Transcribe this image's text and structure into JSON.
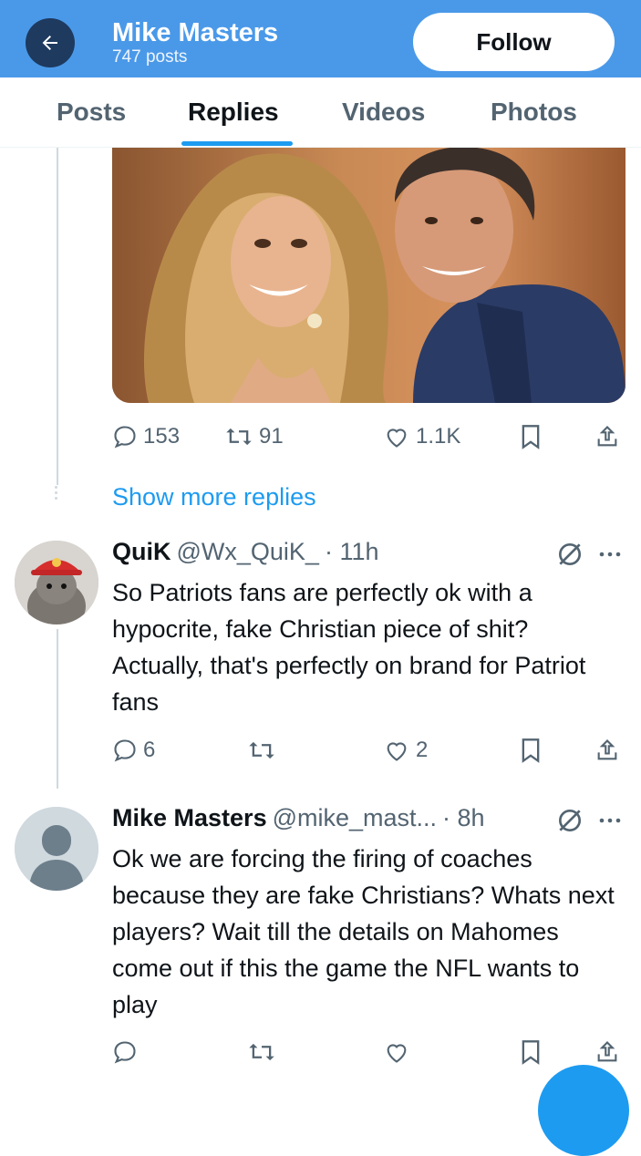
{
  "header": {
    "title": "Mike Masters",
    "subtitle": "747 posts",
    "follow_label": "Follow"
  },
  "tabs": [
    {
      "label": "Posts"
    },
    {
      "label": "Replies"
    },
    {
      "label": "Videos"
    },
    {
      "label": "Photos"
    }
  ],
  "main_post": {
    "image_alt": "photo of a woman with long blonde hair and a man in a navy hoodie",
    "replies": "153",
    "reposts": "91",
    "likes": "1.1K"
  },
  "show_more": "Show more replies",
  "replies": [
    {
      "name": "QuiK",
      "handle": "@Wx_QuiK_",
      "time": "· 11h",
      "text": "So Patriots fans are perfectly ok with a hypocrite, fake Christian piece of shit? Actually, that's perfectly on brand for Patriot fans",
      "replies": "6",
      "reposts": "",
      "likes": "2"
    },
    {
      "name": "Mike Masters",
      "handle": "@mike_mast...",
      "time": "· 8h",
      "text": "Ok we are forcing the firing of coaches because they are fake Christians? Whats next players? Wait till the details on Mahomes come out if this the game the NFL wants to play",
      "replies": "",
      "reposts": "",
      "likes": ""
    }
  ],
  "colors": {
    "header_bg": "#4a99e9",
    "accent": "#1d9bf0",
    "text_secondary": "#536471"
  }
}
